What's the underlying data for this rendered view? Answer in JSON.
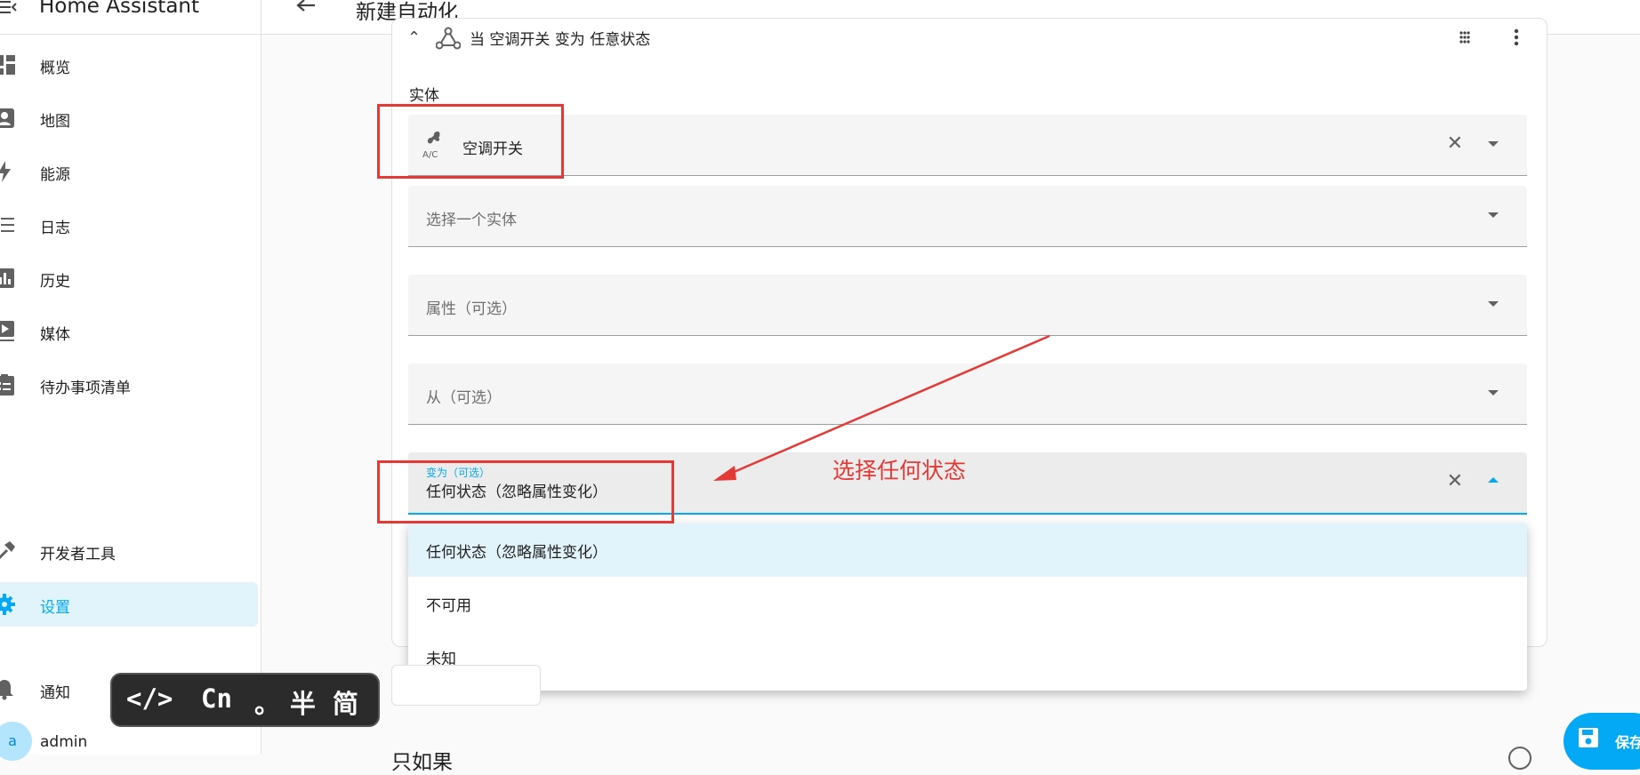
{
  "app": {
    "title": "Home Assistant"
  },
  "sidebar": {
    "items": [
      {
        "label": "概览",
        "icon": "dashboard-icon"
      },
      {
        "label": "地图",
        "icon": "map-account-icon"
      },
      {
        "label": "能源",
        "icon": "lightning-icon"
      },
      {
        "label": "日志",
        "icon": "list-icon"
      },
      {
        "label": "历史",
        "icon": "chart-bar-icon"
      },
      {
        "label": "媒体",
        "icon": "play-box-icon"
      },
      {
        "label": "待办事项清单",
        "icon": "clipboard-list-icon"
      },
      {
        "label": "开发者工具",
        "icon": "hammer-icon"
      },
      {
        "label": "设置",
        "icon": "gear-icon",
        "active": true
      },
      {
        "label": "通知",
        "icon": "bell-icon"
      }
    ],
    "user": {
      "avatar_letter": "a",
      "name": "admin"
    }
  },
  "topbar": {
    "title": "新建自动化"
  },
  "trigger_card": {
    "header": "当 空调开关 变为 任意状态",
    "section_label": "实体",
    "entity": {
      "value": "空调开关",
      "icon": "air-conditioner-icon"
    },
    "entity_add_placeholder": "选择一个实体",
    "attribute_placeholder": "属性（可选）",
    "from_placeholder": "从（可选）",
    "to": {
      "floating_label": "变为（可选）",
      "value": "任何状态（忽略属性变化）"
    }
  },
  "dropdown": {
    "options": [
      {
        "label": "任何状态（忽略属性变化）",
        "selected": true
      },
      {
        "label": "不可用"
      },
      {
        "label": "未知"
      }
    ]
  },
  "annotation": {
    "text": "选择任何状态",
    "color": "#e53935"
  },
  "ime_bar": {
    "tokens": [
      "</>",
      "Cn",
      "。",
      "半",
      "简"
    ]
  },
  "bottom": {
    "section_title": "只如果"
  },
  "save_button": {
    "label": "保存"
  },
  "colors": {
    "accent": "#03a9f4",
    "annotation_red": "#e53935"
  }
}
